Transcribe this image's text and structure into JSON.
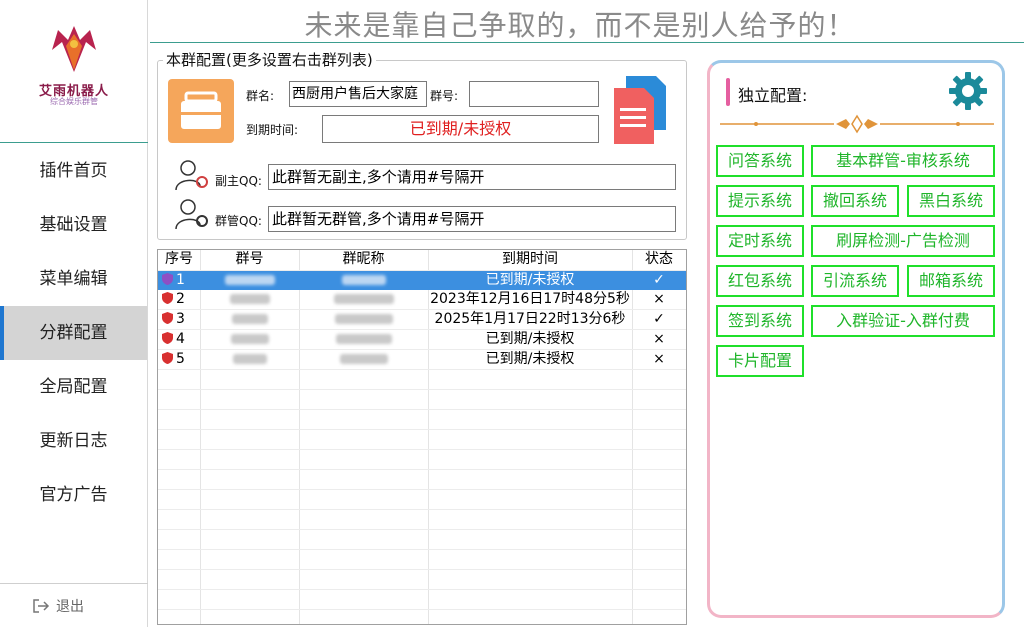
{
  "sidebar": {
    "logo": {
      "title": "艾雨机器人",
      "subtitle": "综合娱乐群管"
    },
    "items": [
      {
        "label": "插件首页"
      },
      {
        "label": "基础设置"
      },
      {
        "label": "菜单编辑"
      },
      {
        "label": "分群配置",
        "active": true
      },
      {
        "label": "全局配置"
      },
      {
        "label": "更新日志"
      },
      {
        "label": "官方广告"
      }
    ],
    "logout_label": "退出"
  },
  "slogan": "未来是靠自己争取的，而不是别人给予的！",
  "group_config": {
    "legend": "本群配置(更多设置右击群列表)",
    "group_name_label": "群名:",
    "group_name_value": "西厨用户售后大家庭",
    "group_no_label": "群号:",
    "group_no_value": "",
    "expire_label": "到期时间:",
    "expire_value": "已到期/未授权",
    "vice_owner_label": "副主QQ:",
    "vice_owner_value": "此群暂无副主,多个请用#号隔开",
    "admin_label": "群管QQ:",
    "admin_value": "此群暂无群管,多个请用#号隔开"
  },
  "table": {
    "headers": [
      "序号",
      "群号",
      "群昵称",
      "到期时间",
      "状态"
    ],
    "rows": [
      {
        "index": "1",
        "expire": "已到期/未授权",
        "status": "✓",
        "selected": true,
        "shield": "purple"
      },
      {
        "index": "2",
        "expire": "2023年12月16日17时48分5秒",
        "status": "×",
        "shield": "red"
      },
      {
        "index": "3",
        "expire": "2025年1月17日22时13分6秒",
        "status": "✓",
        "shield": "red"
      },
      {
        "index": "4",
        "expire": "已到期/未授权",
        "status": "×",
        "shield": "red"
      },
      {
        "index": "5",
        "expire": "已到期/未授权",
        "status": "×",
        "shield": "red"
      }
    ]
  },
  "independent": {
    "title": "独立配置:",
    "buttons": {
      "qa": "问答系统",
      "basic": "基本群管-审核系统",
      "tips": "提示系统",
      "recall": "撤回系统",
      "blackwhite": "黑白系统",
      "timer": "定时系统",
      "spam": "刷屏检测-广告检测",
      "redpacket": "红包系统",
      "traffic": "引流系统",
      "mail": "邮箱系统",
      "checkin": "签到系统",
      "verify": "入群验证-入群付费",
      "card": "卡片配置"
    }
  },
  "colors": {
    "accent": "#1f77d0",
    "green": "#1fe02a",
    "teal": "#3b9d8f",
    "expired": "#e02020"
  }
}
